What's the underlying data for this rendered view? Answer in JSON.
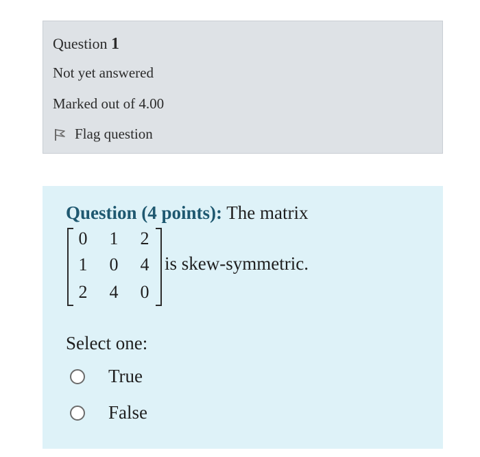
{
  "info": {
    "question_label": "Question",
    "question_number": "1",
    "state": "Not yet answered",
    "grade": "Marked out of 4.00",
    "flag_label": "Flag question"
  },
  "question": {
    "lead": "Question (4 points):",
    "text": " The matrix",
    "matrix": [
      [
        "0",
        "1",
        "2"
      ],
      [
        "1",
        "0",
        "4"
      ],
      [
        "2",
        "4",
        "0"
      ]
    ],
    "after_matrix": "is skew-symmetric.",
    "prompt": "Select one:",
    "options": [
      {
        "label": "True",
        "selected": false
      },
      {
        "label": "False",
        "selected": false
      }
    ]
  },
  "colors": {
    "info_background": "#dee2e6",
    "content_background": "#def2f8",
    "lead_text": "#1e5870"
  },
  "icons": {
    "flag": "flag-icon",
    "radio": "radio-empty-icon"
  }
}
